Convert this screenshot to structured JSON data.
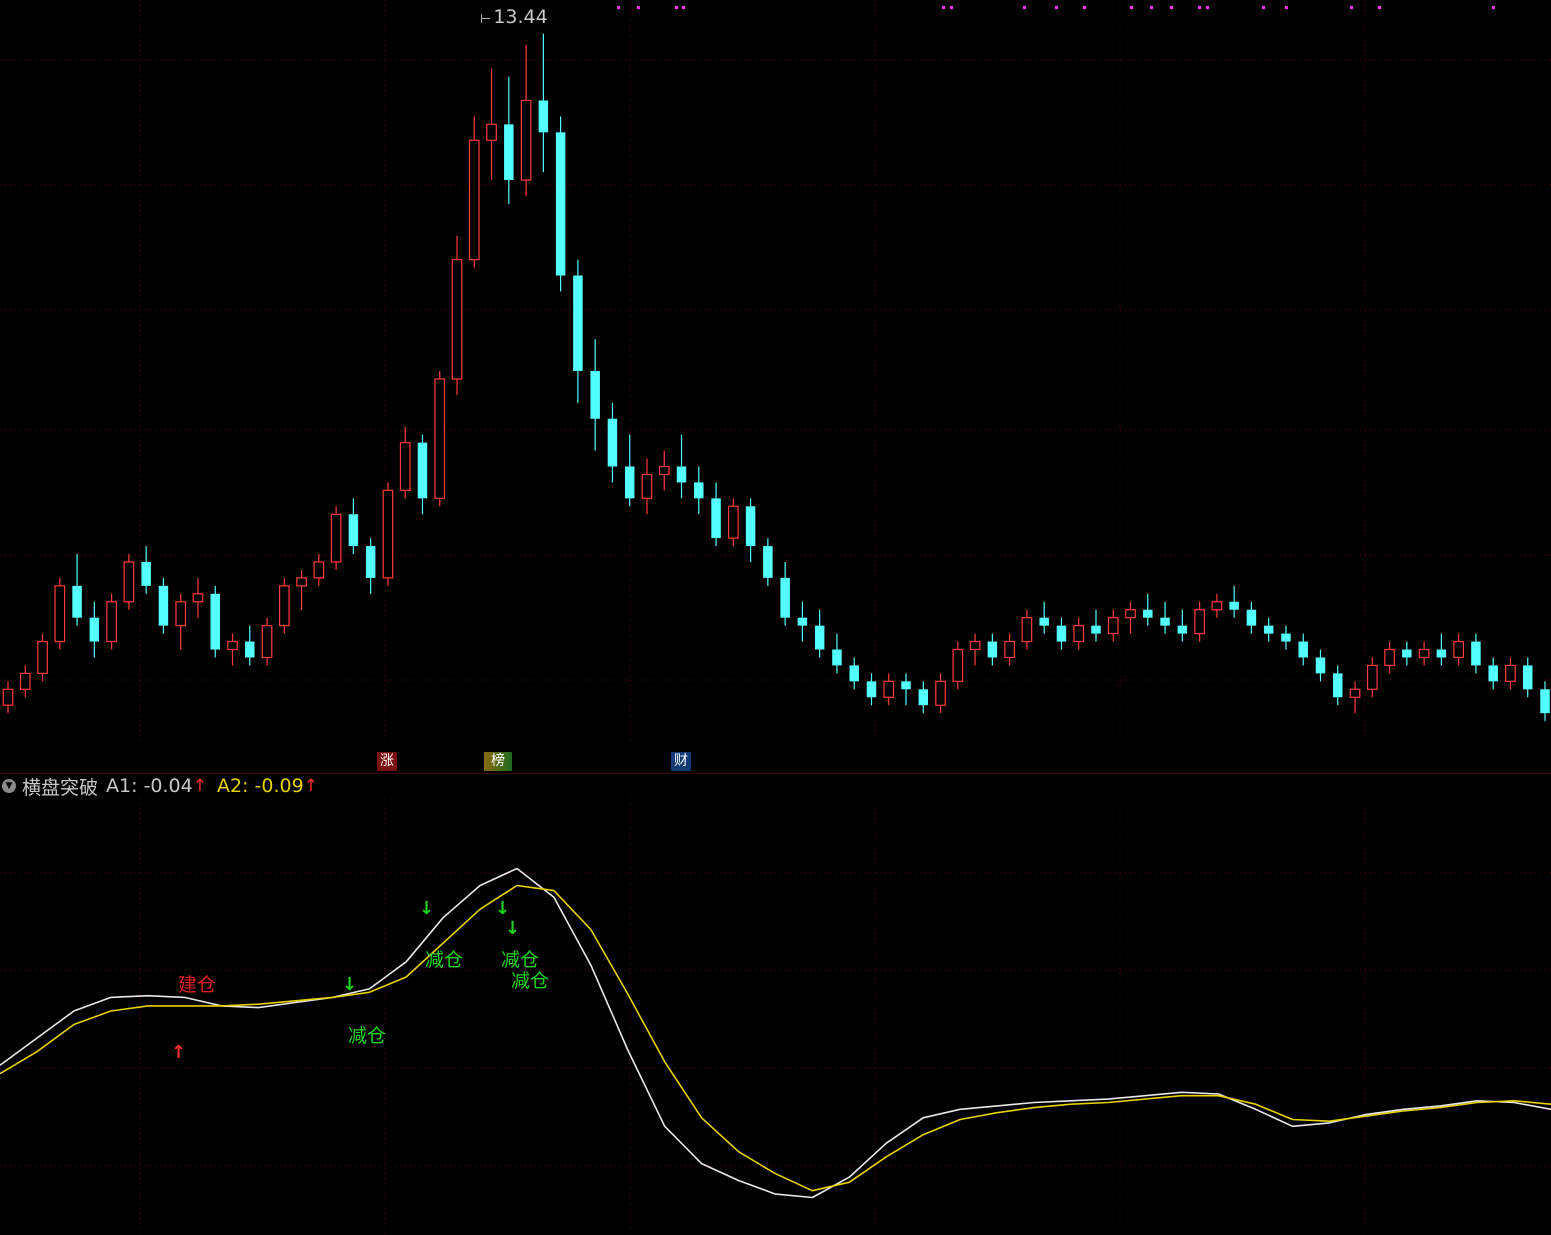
{
  "colors": {
    "up": "#ff3b3b",
    "down": "#54ffff",
    "a1_line": "#e8e8e8",
    "a2_line": "#e6d200",
    "grid": "#5a0a0a",
    "magenta": "#ff33ff"
  },
  "main_chart": {
    "peak_price": "13.44",
    "markers": [
      {
        "label": "涨",
        "name": "zhang"
      },
      {
        "label": "榜",
        "name": "bang"
      },
      {
        "label": "财",
        "name": "cai"
      }
    ]
  },
  "indicator": {
    "name": "横盘突破",
    "a1_label": "A1:",
    "a1_value": "-0.04",
    "a1_arrow": "↑",
    "a2_label": "A2:",
    "a2_value": "-0.09",
    "a2_arrow": "↑",
    "signals": {
      "build": "建仓",
      "reduce1": "减仓",
      "reduce2": "减仓",
      "reduce3": "减仓",
      "reduce4": "减仓"
    }
  },
  "chart_data": [
    {
      "type": "candlestick",
      "peak_label": "13.44",
      "candles": [
        [
          5.0,
          5.3,
          4.9,
          5.2
        ],
        [
          5.2,
          5.5,
          5.1,
          5.4
        ],
        [
          5.4,
          5.9,
          5.3,
          5.8
        ],
        [
          5.8,
          6.6,
          5.7,
          6.5
        ],
        [
          6.5,
          6.9,
          6.0,
          6.1
        ],
        [
          6.1,
          6.3,
          5.6,
          5.8
        ],
        [
          5.8,
          6.4,
          5.7,
          6.3
        ],
        [
          6.3,
          6.9,
          6.2,
          6.8
        ],
        [
          6.8,
          7.0,
          6.4,
          6.5
        ],
        [
          6.5,
          6.6,
          5.9,
          6.0
        ],
        [
          6.0,
          6.4,
          5.7,
          6.3
        ],
        [
          6.3,
          6.6,
          6.1,
          6.4
        ],
        [
          6.4,
          6.5,
          5.6,
          5.7
        ],
        [
          5.7,
          5.9,
          5.5,
          5.8
        ],
        [
          5.8,
          6.0,
          5.5,
          5.6
        ],
        [
          5.6,
          6.1,
          5.5,
          6.0
        ],
        [
          6.0,
          6.6,
          5.9,
          6.5
        ],
        [
          6.5,
          6.7,
          6.2,
          6.6
        ],
        [
          6.6,
          6.9,
          6.5,
          6.8
        ],
        [
          6.8,
          7.5,
          6.7,
          7.4
        ],
        [
          7.4,
          7.6,
          6.9,
          7.0
        ],
        [
          7.0,
          7.1,
          6.4,
          6.6
        ],
        [
          6.6,
          7.8,
          6.5,
          7.7
        ],
        [
          7.7,
          8.5,
          7.6,
          8.3
        ],
        [
          8.3,
          8.4,
          7.4,
          7.6
        ],
        [
          7.6,
          9.2,
          7.5,
          9.1
        ],
        [
          9.1,
          10.9,
          8.9,
          10.6
        ],
        [
          10.6,
          12.4,
          10.5,
          12.1
        ],
        [
          12.1,
          13.0,
          11.6,
          12.3
        ],
        [
          12.3,
          12.9,
          11.3,
          11.6
        ],
        [
          11.6,
          13.3,
          11.4,
          12.6
        ],
        [
          12.6,
          13.44,
          11.7,
          12.2
        ],
        [
          12.2,
          12.4,
          10.2,
          10.4
        ],
        [
          10.4,
          10.6,
          8.8,
          9.2
        ],
        [
          9.2,
          9.6,
          8.2,
          8.6
        ],
        [
          8.6,
          8.8,
          7.8,
          8.0
        ],
        [
          8.0,
          8.4,
          7.5,
          7.6
        ],
        [
          7.6,
          8.1,
          7.4,
          7.9
        ],
        [
          7.9,
          8.2,
          7.7,
          8.0
        ],
        [
          8.0,
          8.4,
          7.6,
          7.8
        ],
        [
          7.8,
          8.0,
          7.4,
          7.6
        ],
        [
          7.6,
          7.8,
          7.0,
          7.1
        ],
        [
          7.1,
          7.6,
          7.0,
          7.5
        ],
        [
          7.5,
          7.6,
          6.8,
          7.0
        ],
        [
          7.0,
          7.1,
          6.5,
          6.6
        ],
        [
          6.6,
          6.8,
          6.0,
          6.1
        ],
        [
          6.1,
          6.3,
          5.8,
          6.0
        ],
        [
          6.0,
          6.2,
          5.6,
          5.7
        ],
        [
          5.7,
          5.9,
          5.4,
          5.5
        ],
        [
          5.5,
          5.6,
          5.2,
          5.3
        ],
        [
          5.3,
          5.4,
          5.0,
          5.1
        ],
        [
          5.1,
          5.4,
          5.0,
          5.3
        ],
        [
          5.3,
          5.4,
          5.0,
          5.2
        ],
        [
          5.2,
          5.3,
          4.9,
          5.0
        ],
        [
          5.0,
          5.4,
          4.9,
          5.3
        ],
        [
          5.3,
          5.8,
          5.2,
          5.7
        ],
        [
          5.7,
          5.9,
          5.5,
          5.8
        ],
        [
          5.8,
          5.9,
          5.5,
          5.6
        ],
        [
          5.6,
          5.9,
          5.5,
          5.8
        ],
        [
          5.8,
          6.2,
          5.7,
          6.1
        ],
        [
          6.1,
          6.3,
          5.9,
          6.0
        ],
        [
          6.0,
          6.1,
          5.7,
          5.8
        ],
        [
          5.8,
          6.1,
          5.7,
          6.0
        ],
        [
          6.0,
          6.2,
          5.8,
          5.9
        ],
        [
          5.9,
          6.2,
          5.8,
          6.1
        ],
        [
          6.1,
          6.3,
          5.9,
          6.2
        ],
        [
          6.2,
          6.4,
          6.0,
          6.1
        ],
        [
          6.1,
          6.3,
          5.9,
          6.0
        ],
        [
          6.0,
          6.2,
          5.8,
          5.9
        ],
        [
          5.9,
          6.3,
          5.8,
          6.2
        ],
        [
          6.2,
          6.4,
          6.1,
          6.3
        ],
        [
          6.3,
          6.5,
          6.1,
          6.2
        ],
        [
          6.2,
          6.3,
          5.9,
          6.0
        ],
        [
          6.0,
          6.1,
          5.8,
          5.9
        ],
        [
          5.9,
          6.0,
          5.7,
          5.8
        ],
        [
          5.8,
          5.9,
          5.5,
          5.6
        ],
        [
          5.6,
          5.7,
          5.3,
          5.4
        ],
        [
          5.4,
          5.5,
          5.0,
          5.1
        ],
        [
          5.1,
          5.3,
          4.9,
          5.2
        ],
        [
          5.2,
          5.6,
          5.1,
          5.5
        ],
        [
          5.5,
          5.8,
          5.4,
          5.7
        ],
        [
          5.7,
          5.8,
          5.5,
          5.6
        ],
        [
          5.6,
          5.8,
          5.5,
          5.7
        ],
        [
          5.7,
          5.9,
          5.5,
          5.6
        ],
        [
          5.6,
          5.9,
          5.5,
          5.8
        ],
        [
          5.8,
          5.9,
          5.4,
          5.5
        ],
        [
          5.5,
          5.6,
          5.2,
          5.3
        ],
        [
          5.3,
          5.6,
          5.2,
          5.5
        ],
        [
          5.5,
          5.6,
          5.1,
          5.2
        ],
        [
          5.2,
          5.3,
          4.8,
          4.9
        ]
      ]
    },
    {
      "type": "line",
      "title": "横盘突破",
      "series": [
        {
          "name": "A1",
          "values": [
            -0.04,
            0.12,
            0.28,
            0.36,
            0.37,
            0.36,
            0.31,
            0.3,
            0.33,
            0.36,
            0.41,
            0.57,
            0.83,
            1.02,
            1.12,
            0.95,
            0.55,
            0.05,
            -0.4,
            -0.62,
            -0.72,
            -0.8,
            -0.82,
            -0.7,
            -0.5,
            -0.35,
            -0.3,
            -0.28,
            -0.26,
            -0.25,
            -0.24,
            -0.22,
            -0.2,
            -0.21,
            -0.3,
            -0.4,
            -0.38,
            -0.33,
            -0.3,
            -0.28,
            -0.25,
            -0.26,
            -0.3
          ]
        },
        {
          "name": "A2",
          "values": [
            -0.09,
            0.04,
            0.2,
            0.28,
            0.31,
            0.31,
            0.31,
            0.32,
            0.34,
            0.36,
            0.39,
            0.48,
            0.68,
            0.88,
            1.02,
            0.99,
            0.76,
            0.38,
            -0.02,
            -0.35,
            -0.55,
            -0.68,
            -0.78,
            -0.73,
            -0.58,
            -0.45,
            -0.36,
            -0.32,
            -0.29,
            -0.27,
            -0.26,
            -0.24,
            -0.22,
            -0.22,
            -0.27,
            -0.36,
            -0.37,
            -0.34,
            -0.31,
            -0.29,
            -0.26,
            -0.25,
            -0.27
          ]
        }
      ],
      "signals": [
        {
          "label": "建仓",
          "type": "buy"
        },
        {
          "label": "减仓",
          "type": "sell"
        },
        {
          "label": "减仓",
          "type": "sell"
        },
        {
          "label": "减仓",
          "type": "sell"
        },
        {
          "label": "减仓",
          "type": "sell"
        }
      ]
    }
  ]
}
